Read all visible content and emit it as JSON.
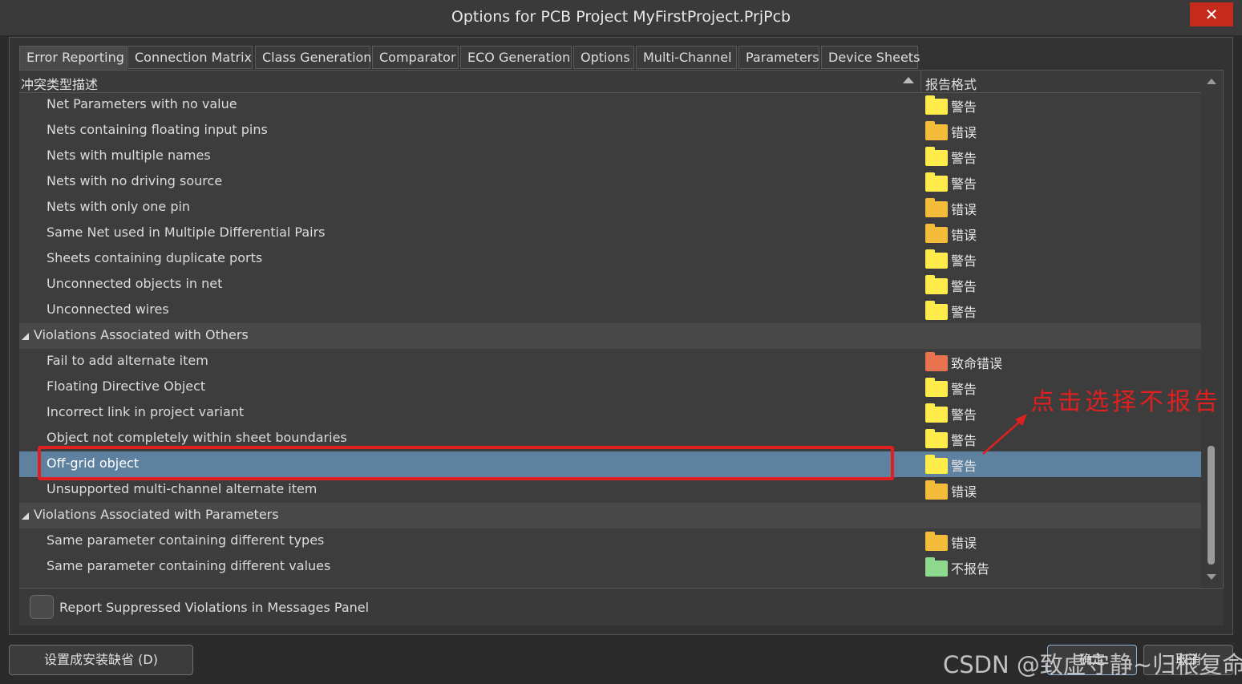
{
  "window": {
    "title": "Options for PCB Project MyFirstProject.PrjPcb",
    "close_label": "✕"
  },
  "tabs": [
    "Error Reporting",
    "Connection Matrix",
    "Class Generation",
    "Comparator",
    "ECO Generation",
    "Options",
    "Multi-Channel",
    "Parameters",
    "Device Sheets"
  ],
  "active_tab": "Error Reporting",
  "table": {
    "col_desc": "冲突类型描述",
    "col_format": "报告格式"
  },
  "rows": [
    {
      "desc": "Net Parameters with no value",
      "fmt": "警告",
      "color": "#ffec4a"
    },
    {
      "desc": "Nets containing floating input pins",
      "fmt": "错误",
      "color": "#f5bb3b"
    },
    {
      "desc": "Nets with multiple names",
      "fmt": "警告",
      "color": "#ffec4a"
    },
    {
      "desc": "Nets with no driving source",
      "fmt": "警告",
      "color": "#ffec4a"
    },
    {
      "desc": "Nets with only one pin",
      "fmt": "错误",
      "color": "#f5bb3b"
    },
    {
      "desc": "Same Net used in Multiple Differential Pairs",
      "fmt": "错误",
      "color": "#f5bb3b"
    },
    {
      "desc": "Sheets containing duplicate ports",
      "fmt": "警告",
      "color": "#ffec4a"
    },
    {
      "desc": "Unconnected objects in net",
      "fmt": "警告",
      "color": "#ffec4a"
    },
    {
      "desc": "Unconnected wires",
      "fmt": "警告",
      "color": "#ffec4a"
    },
    {
      "group": true,
      "desc": "Violations Associated with Others"
    },
    {
      "desc": "Fail to add alternate item",
      "fmt": "致命错误",
      "color": "#e8734e"
    },
    {
      "desc": "Floating Directive Object",
      "fmt": "警告",
      "color": "#ffec4a"
    },
    {
      "desc": "Incorrect link in project variant",
      "fmt": "警告",
      "color": "#ffec4a"
    },
    {
      "desc": "Object not completely within sheet boundaries",
      "fmt": "警告",
      "color": "#ffec4a"
    },
    {
      "desc": "Off-grid object",
      "fmt": "警告",
      "color": "#ffec4a",
      "selected": true
    },
    {
      "desc": "Unsupported multi-channel alternate item",
      "fmt": "错误",
      "color": "#f5bb3b"
    },
    {
      "group": true,
      "desc": "Violations Associated with Parameters"
    },
    {
      "desc": "Same parameter containing different types",
      "fmt": "错误",
      "color": "#f5bb3b"
    },
    {
      "desc": "Same parameter containing different values",
      "fmt": "不报告",
      "color": "#8fd98f"
    }
  ],
  "checkbox": {
    "label": "Report Suppressed Violations in Messages Panel",
    "checked": false
  },
  "buttons": {
    "default_label": "设置成安装缺省 (D)",
    "ok_label": "确定",
    "cancel_label": "取消"
  },
  "annotation": "点击选择不报告",
  "watermark": "CSDN @致虚守静~归根复命"
}
